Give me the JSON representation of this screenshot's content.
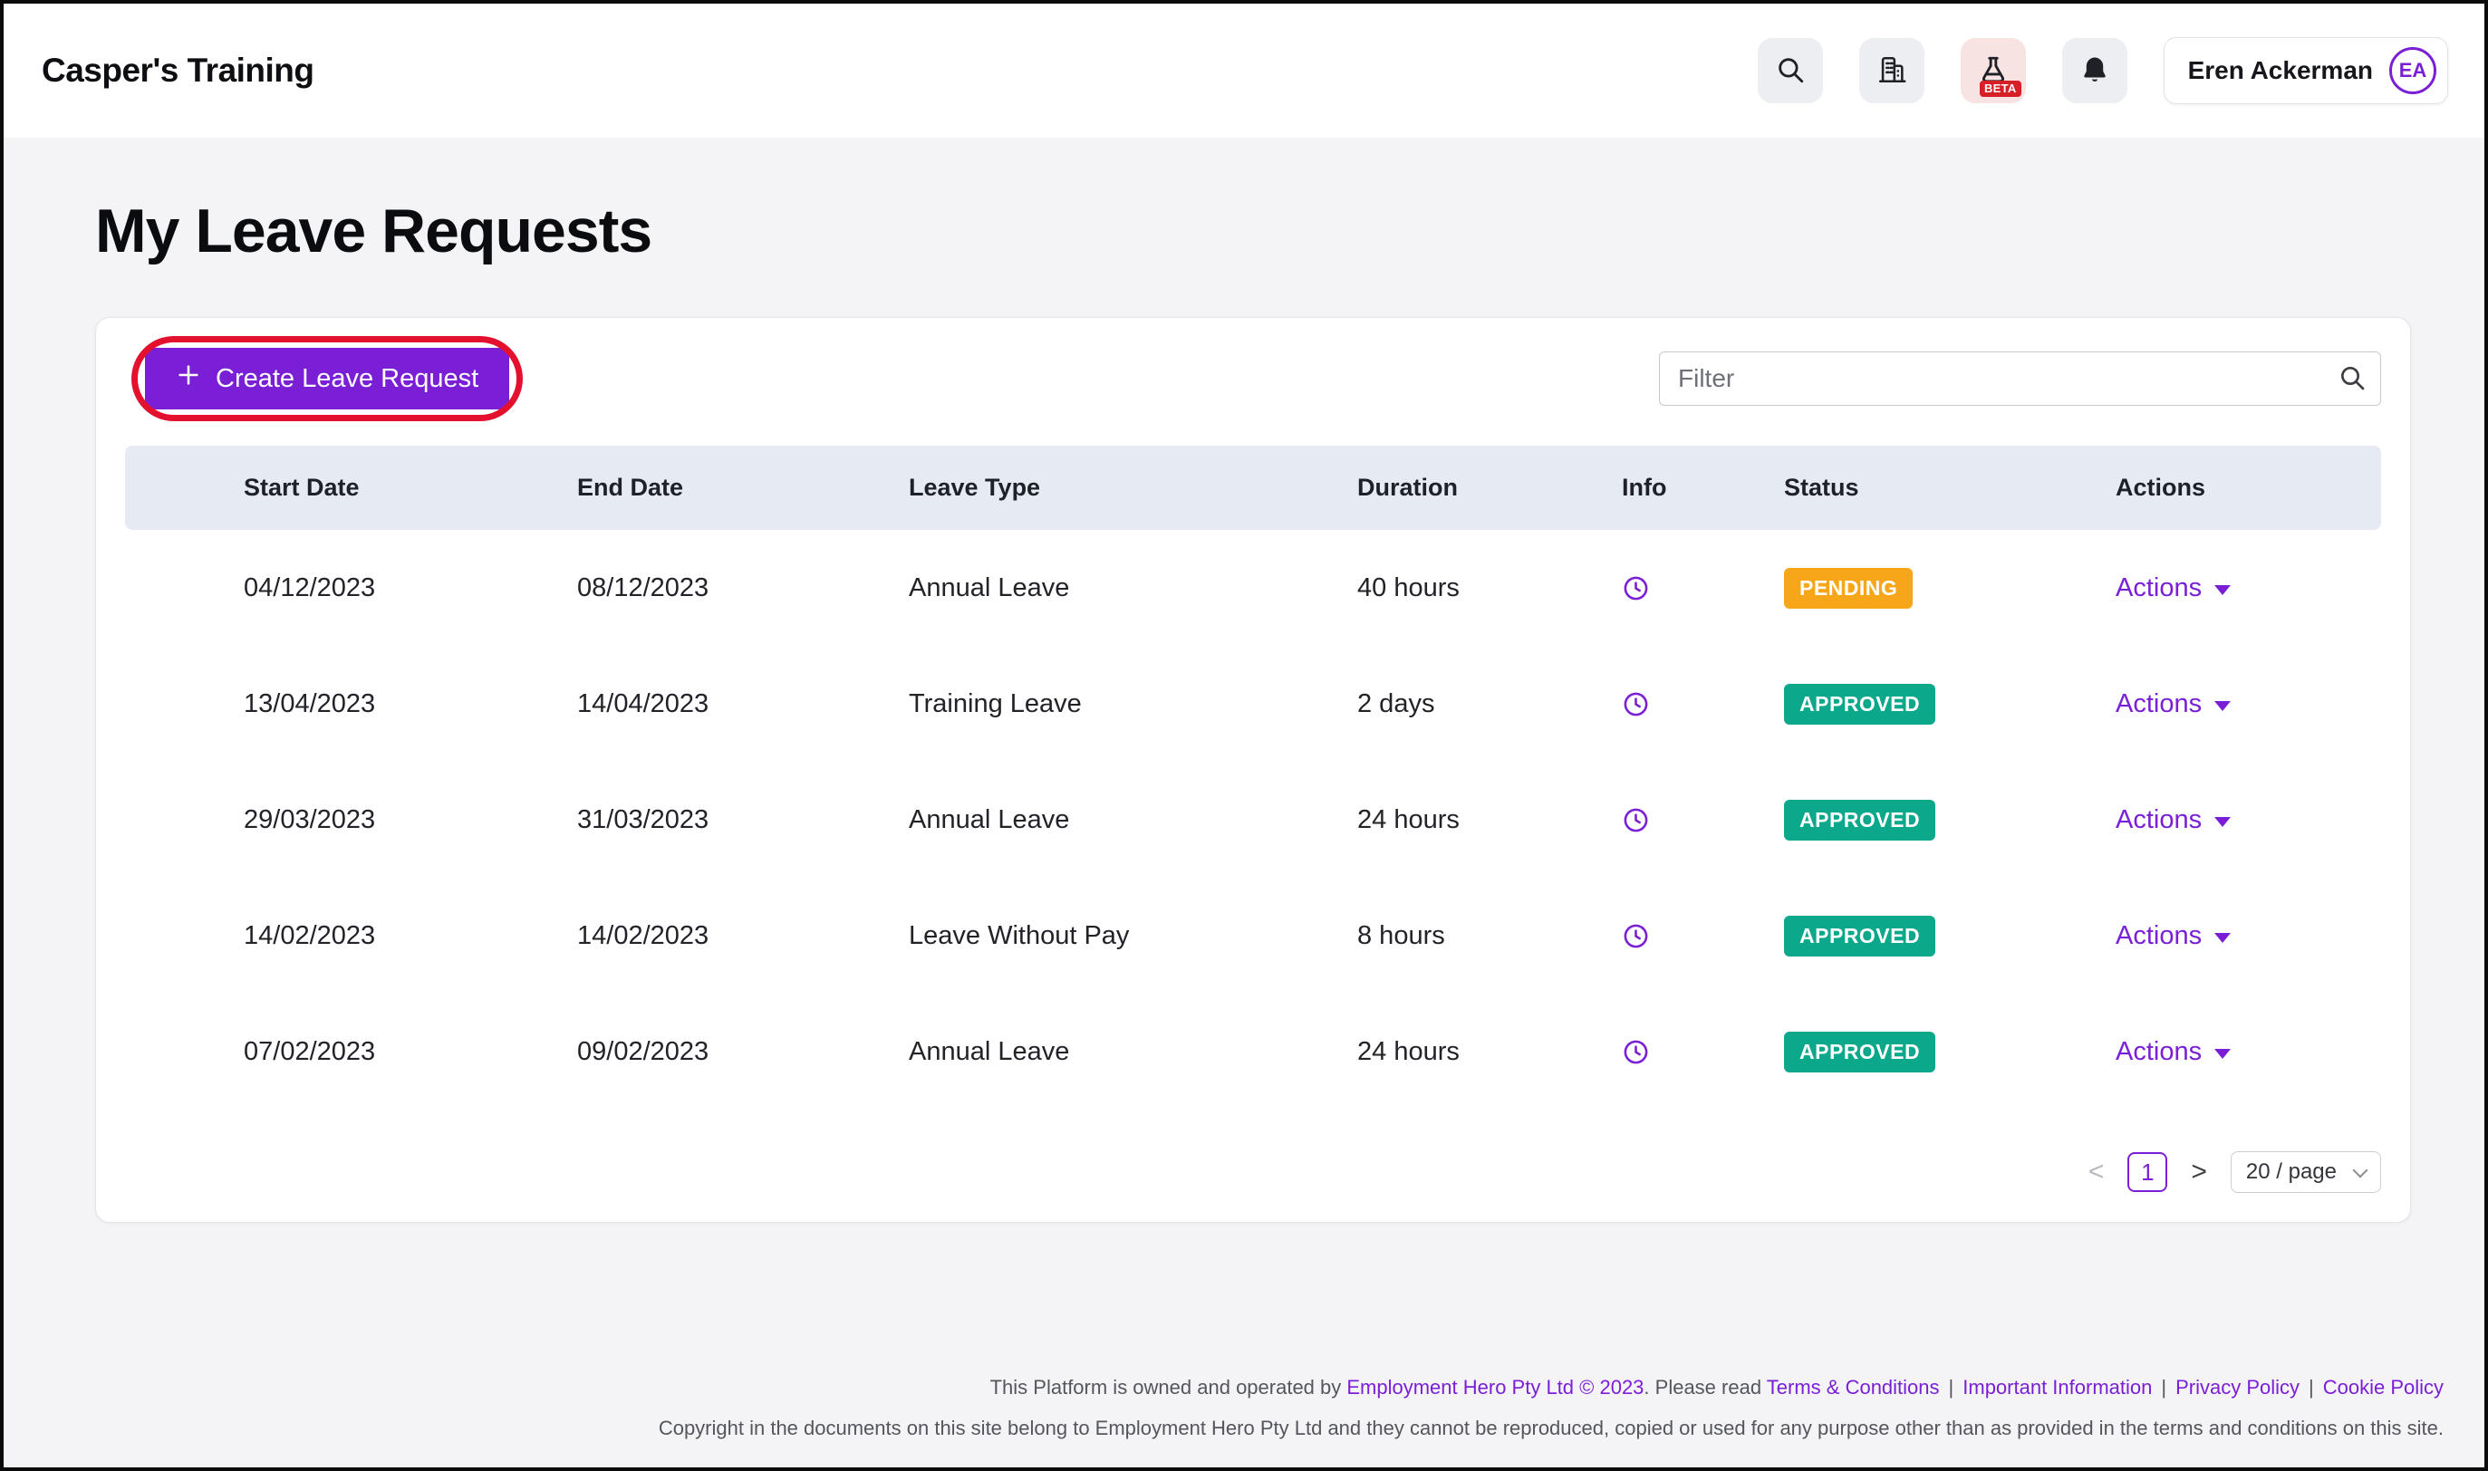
{
  "header": {
    "app_title": "Casper's Training",
    "user_name": "Eren Ackerman",
    "user_initials": "EA",
    "beta_label": "BETA"
  },
  "page": {
    "title": "My Leave Requests"
  },
  "toolbar": {
    "create_button_label": "Create Leave Request",
    "filter_placeholder": "Filter"
  },
  "table": {
    "columns": [
      "Start Date",
      "End Date",
      "Leave Type",
      "Duration",
      "Info",
      "Status",
      "Actions"
    ],
    "actions_label": "Actions",
    "rows": [
      {
        "start_date": "04/12/2023",
        "end_date": "08/12/2023",
        "leave_type": "Annual Leave",
        "duration": "40 hours",
        "status": "PENDING"
      },
      {
        "start_date": "13/04/2023",
        "end_date": "14/04/2023",
        "leave_type": "Training Leave",
        "duration": "2 days",
        "status": "APPROVED"
      },
      {
        "start_date": "29/03/2023",
        "end_date": "31/03/2023",
        "leave_type": "Annual Leave",
        "duration": "24 hours",
        "status": "APPROVED"
      },
      {
        "start_date": "14/02/2023",
        "end_date": "14/02/2023",
        "leave_type": "Leave Without Pay",
        "duration": "8 hours",
        "status": "APPROVED"
      },
      {
        "start_date": "07/02/2023",
        "end_date": "09/02/2023",
        "leave_type": "Annual Leave",
        "duration": "24 hours",
        "status": "APPROVED"
      }
    ]
  },
  "pagination": {
    "prev_label": "<",
    "page": "1",
    "next_label": ">",
    "page_size": "20 / page"
  },
  "footer": {
    "text1": "This Platform is owned and operated by ",
    "company_link": "Employment Hero Pty Ltd © 2023",
    "text2": ". Please read ",
    "terms_link": "Terms & Conditions",
    "separator": "|",
    "important_link": "Important Information",
    "privacy_link": "Privacy Policy",
    "cookie_link": "Cookie Policy",
    "copyright": "Copyright in the documents on this site belong to Employment Hero Pty Ltd and they cannot be reproduced, copied or used for any purpose other than as provided in the terms and conditions on this site."
  },
  "icons": {
    "topbar": [
      "search-icon",
      "building-icon",
      "beta-flask-icon",
      "bell-icon"
    ],
    "filter": "search-icon",
    "info_column": "clock-icon",
    "actions": "chevron-down-icon"
  },
  "colors": {
    "accent_purple": "#7A1FD6",
    "pending_orange": "#F7A61A",
    "approved_teal": "#0BA88C",
    "annotation_red": "#E4112E",
    "table_header_bg": "#E6EAF2"
  }
}
